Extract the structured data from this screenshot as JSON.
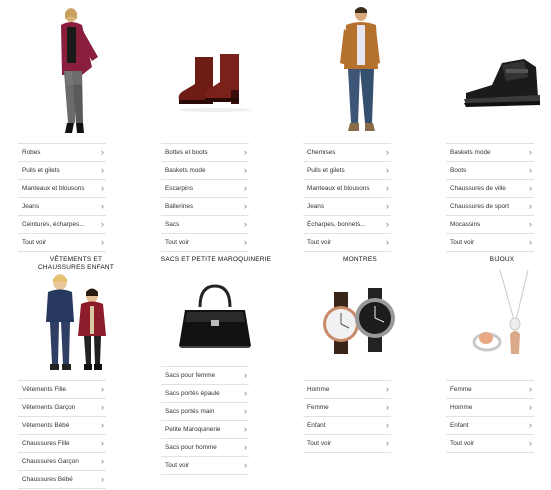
{
  "sections": [
    {
      "title": "",
      "image": "woman-coat-figure",
      "items": [
        "Robes",
        "Pulls et gilets",
        "Manteaux et blousons",
        "Jeans",
        "Ceintures, écharpes...",
        "Tout voir"
      ]
    },
    {
      "title": "",
      "image": "burgundy-ankle-boots",
      "items": [
        "Bottes et boots",
        "Baskets mode",
        "Escarpins",
        "Ballerines",
        "Sacs",
        "Tout voir"
      ]
    },
    {
      "title": "",
      "image": "man-camel-jacket-figure",
      "items": [
        "Chemises",
        "Pulls et gilets",
        "Manteaux et blousons",
        "Jeans",
        "Écharpes, bonnets...",
        "Tout voir"
      ]
    },
    {
      "title": "",
      "image": "black-high-top-sneaker",
      "items": [
        "Baskets mode",
        "Boots",
        "Chaussures de ville",
        "Chaussures de sport",
        "Mocassins",
        "Tout voir"
      ]
    },
    {
      "title": "VÊTEMENTS ET CHAUSSURES ENFANT",
      "image": "two-children-figures",
      "items": [
        "Vêtements Fille",
        "Vêtements Garçon",
        "Vêtements Bébé",
        "Chaussures Fille",
        "Chaussures Garçon",
        "Chaussures Bébé"
      ]
    },
    {
      "title": "SACS ET PETITE MAROQUINERIE",
      "image": "black-handbag",
      "items": [
        "Sacs pour femme",
        "Sacs portés épaule",
        "Sacs portés main",
        "Petite Maroquinerie",
        "Sacs pour homme",
        "Tout voir"
      ]
    },
    {
      "title": "MONTRES",
      "image": "two-watches",
      "items": [
        "Homme",
        "Femme",
        "Enfant",
        "Tout voir"
      ]
    },
    {
      "title": "BIJOUX",
      "image": "jewelry-necklace-ring",
      "items": [
        "Femme",
        "Homme",
        "Enfant",
        "Tout voir"
      ]
    }
  ],
  "colors": {
    "divider": "#e2e2e2",
    "chevron": "#777777",
    "text": "#333333"
  },
  "icons": {
    "chevron": "›"
  }
}
